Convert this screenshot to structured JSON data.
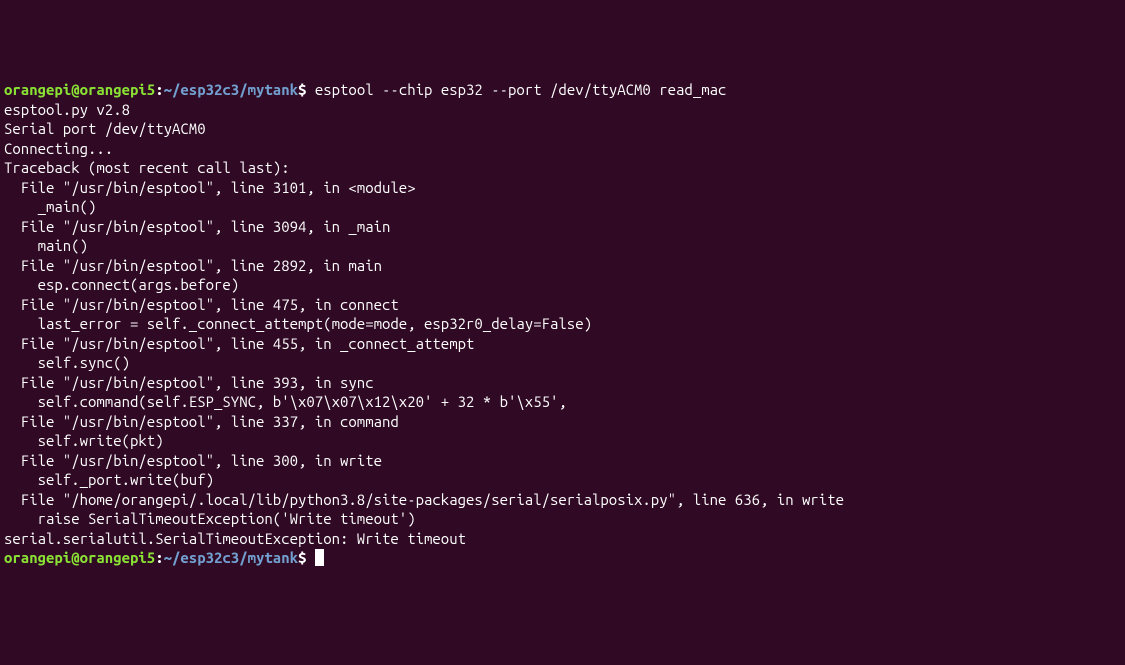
{
  "prompt1": {
    "user": "orangepi@orangepi5",
    "colon": ":",
    "path": "~/esp32c3/mytank",
    "dollar": "$ ",
    "command": "esptool --chip esp32 --port /dev/ttyACM0 read_mac"
  },
  "output": {
    "l01": "esptool.py v2.8",
    "l02": "Serial port /dev/ttyACM0",
    "l03": "Connecting...",
    "l04": "Traceback (most recent call last):",
    "l05": "  File \"/usr/bin/esptool\", line 3101, in <module>",
    "l06": "    _main()",
    "l07": "  File \"/usr/bin/esptool\", line 3094, in _main",
    "l08": "    main()",
    "l09": "  File \"/usr/bin/esptool\", line 2892, in main",
    "l10": "    esp.connect(args.before)",
    "l11": "  File \"/usr/bin/esptool\", line 475, in connect",
    "l12": "    last_error = self._connect_attempt(mode=mode, esp32r0_delay=False)",
    "l13": "  File \"/usr/bin/esptool\", line 455, in _connect_attempt",
    "l14": "    self.sync()",
    "l15": "  File \"/usr/bin/esptool\", line 393, in sync",
    "l16": "    self.command(self.ESP_SYNC, b'\\x07\\x07\\x12\\x20' + 32 * b'\\x55',",
    "l17": "  File \"/usr/bin/esptool\", line 337, in command",
    "l18": "    self.write(pkt)",
    "l19": "  File \"/usr/bin/esptool\", line 300, in write",
    "l20": "    self._port.write(buf)",
    "l21": "  File \"/home/orangepi/.local/lib/python3.8/site-packages/serial/serialposix.py\", line 636, in write",
    "l22": "    raise SerialTimeoutException('Write timeout')",
    "l23": "serial.serialutil.SerialTimeoutException: Write timeout"
  },
  "prompt2": {
    "user": "orangepi@orangepi5",
    "colon": ":",
    "path": "~/esp32c3/mytank",
    "dollar": "$ "
  }
}
